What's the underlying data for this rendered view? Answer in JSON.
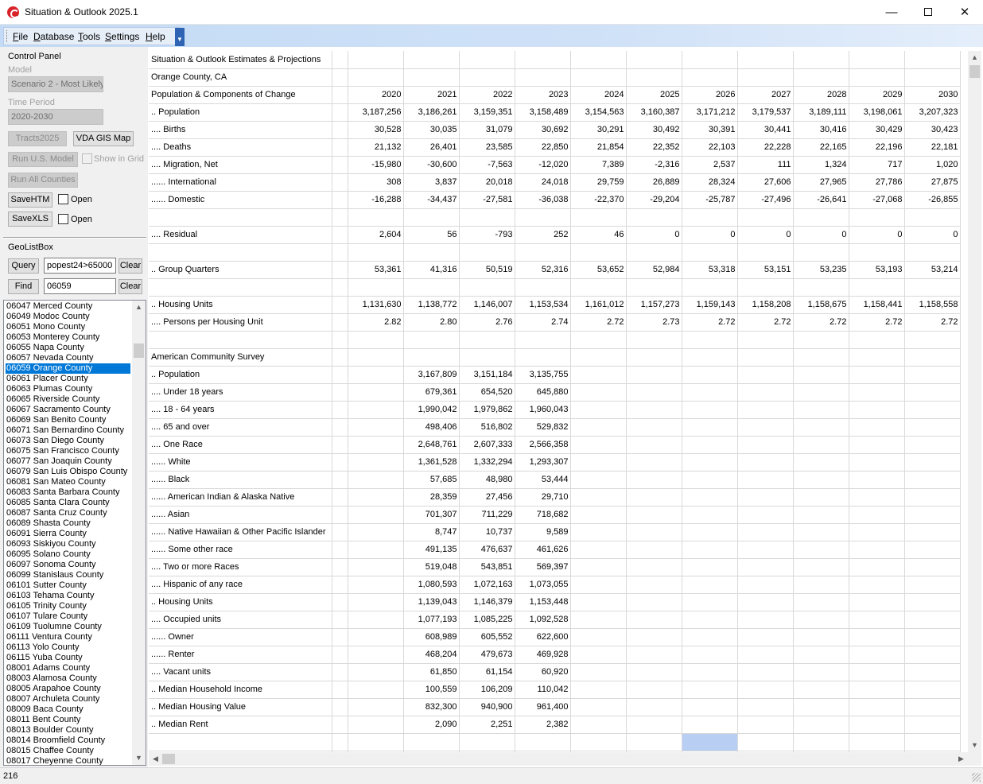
{
  "window": {
    "title": "Situation & Outlook 2025.1"
  },
  "menu": [
    {
      "pre": "",
      "u": "F",
      "post": "ile"
    },
    {
      "pre": "",
      "u": "D",
      "post": "atabase"
    },
    {
      "pre": "",
      "u": "T",
      "post": "ools"
    },
    {
      "pre": "",
      "u": "S",
      "post": "ettings"
    },
    {
      "pre": "",
      "u": "H",
      "post": "elp"
    }
  ],
  "control_panel": {
    "title": "Control Panel",
    "model_label": "Model",
    "model_value": "Scenario 2 - Most Likely",
    "period_label": "Time Period",
    "period_value": "2020-2030",
    "tracts_button": "Tracts2025",
    "gis_button": "VDA GIS Map",
    "run_us_button": "Run U.S. Model",
    "show_in_grid": "Show in Grid",
    "run_all_button": "Run All Counties",
    "save_htm_button": "SaveHTM",
    "open_htm": "Open",
    "save_xls_button": "SaveXLS",
    "open_xls": "Open"
  },
  "geolistbox": {
    "title": "GeoListBox",
    "query_button": "Query",
    "query_value": "popest24>65000",
    "clear1": "Clear",
    "find_button": "Find",
    "find_value": "06059",
    "clear2": "Clear",
    "selected": "06059 Orange County",
    "items": [
      "06047 Merced County",
      "06049 Modoc County",
      "06051 Mono County",
      "06053 Monterey County",
      "06055 Napa County",
      "06057 Nevada County",
      "06059 Orange County",
      "06061 Placer County",
      "06063 Plumas County",
      "06065 Riverside County",
      "06067 Sacramento County",
      "06069 San Benito County",
      "06071 San Bernardino County",
      "06073 San Diego County",
      "06075 San Francisco County",
      "06077 San Joaquin County",
      "06079 San Luis Obispo County",
      "06081 San Mateo County",
      "06083 Santa Barbara County",
      "06085 Santa Clara County",
      "06087 Santa Cruz County",
      "06089 Shasta County",
      "06091 Sierra County",
      "06093 Siskiyou County",
      "06095 Solano County",
      "06097 Sonoma County",
      "06099 Stanislaus County",
      "06101 Sutter County",
      "06103 Tehama County",
      "06105 Trinity County",
      "06107 Tulare County",
      "06109 Tuolumne County",
      "06111 Ventura County",
      "06113 Yolo County",
      "06115 Yuba County",
      "08001 Adams County",
      "08003 Alamosa County",
      "08005 Arapahoe County",
      "08007 Archuleta County",
      "08009 Baca County",
      "08011 Bent County",
      "08013 Boulder County",
      "08014 Broomfield County",
      "08015 Chaffee County",
      "08017 Cheyenne County"
    ]
  },
  "grid": {
    "rows": [
      {
        "label": "Situation & Outlook Estimates & Projections",
        "v": []
      },
      {
        "label": "Orange County, CA",
        "v": []
      },
      {
        "label": "Population & Components of Change",
        "v": [
          "",
          "2020",
          "2021",
          "2022",
          "2023",
          "2024",
          "2025",
          "2026",
          "2027",
          "2028",
          "2029",
          "2030"
        ]
      },
      {
        "label": ".. Population",
        "v": [
          "",
          "3,187,256",
          "3,186,261",
          "3,159,351",
          "3,158,489",
          "3,154,563",
          "3,160,387",
          "3,171,212",
          "3,179,537",
          "3,189,111",
          "3,198,061",
          "3,207,323"
        ]
      },
      {
        "label": ".... Births",
        "v": [
          "",
          "30,528",
          "30,035",
          "31,079",
          "30,692",
          "30,291",
          "30,492",
          "30,391",
          "30,441",
          "30,416",
          "30,429",
          "30,423"
        ]
      },
      {
        "label": ".... Deaths",
        "v": [
          "",
          "21,132",
          "26,401",
          "23,585",
          "22,850",
          "21,854",
          "22,352",
          "22,103",
          "22,228",
          "22,165",
          "22,196",
          "22,181"
        ]
      },
      {
        "label": ".... Migration, Net",
        "v": [
          "",
          "-15,980",
          "-30,600",
          "-7,563",
          "-12,020",
          "7,389",
          "-2,316",
          "2,537",
          "111",
          "1,324",
          "717",
          "1,020"
        ]
      },
      {
        "label": "...... International",
        "v": [
          "",
          "308",
          "3,837",
          "20,018",
          "24,018",
          "29,759",
          "26,889",
          "28,324",
          "27,606",
          "27,965",
          "27,786",
          "27,875"
        ]
      },
      {
        "label": "...... Domestic",
        "v": [
          "",
          "-16,288",
          "-34,437",
          "-27,581",
          "-36,038",
          "-22,370",
          "-29,204",
          "-25,787",
          "-27,496",
          "-26,641",
          "-27,068",
          "-26,855"
        ]
      },
      {
        "label": "",
        "v": []
      },
      {
        "label": ".... Residual",
        "v": [
          "",
          "2,604",
          "56",
          "-793",
          "252",
          "46",
          "0",
          "0",
          "0",
          "0",
          "0",
          "0"
        ]
      },
      {
        "label": "",
        "v": []
      },
      {
        "label": ".. Group Quarters",
        "v": [
          "",
          "53,361",
          "41,316",
          "50,519",
          "52,316",
          "53,652",
          "52,984",
          "53,318",
          "53,151",
          "53,235",
          "53,193",
          "53,214"
        ]
      },
      {
        "label": "",
        "v": []
      },
      {
        "label": ".. Housing Units",
        "v": [
          "",
          "1,131,630",
          "1,138,772",
          "1,146,007",
          "1,153,534",
          "1,161,012",
          "1,157,273",
          "1,159,143",
          "1,158,208",
          "1,158,675",
          "1,158,441",
          "1,158,558"
        ]
      },
      {
        "label": ".... Persons per Housing Unit",
        "v": [
          "",
          "2.82",
          "2.80",
          "2.76",
          "2.74",
          "2.72",
          "2.73",
          "2.72",
          "2.72",
          "2.72",
          "2.72",
          "2.72"
        ]
      },
      {
        "label": "",
        "v": []
      },
      {
        "label": "American Community Survey",
        "v": []
      },
      {
        "label": ".. Population",
        "v": [
          "",
          "",
          "3,167,809",
          "3,151,184",
          "3,135,755"
        ]
      },
      {
        "label": ".... Under 18 years",
        "v": [
          "",
          "",
          "679,361",
          "654,520",
          "645,880"
        ]
      },
      {
        "label": ".... 18 - 64 years",
        "v": [
          "",
          "",
          "1,990,042",
          "1,979,862",
          "1,960,043"
        ]
      },
      {
        "label": ".... 65 and over",
        "v": [
          "",
          "",
          "498,406",
          "516,802",
          "529,832"
        ]
      },
      {
        "label": ".... One Race",
        "v": [
          "",
          "",
          "2,648,761",
          "2,607,333",
          "2,566,358"
        ]
      },
      {
        "label": "...... White",
        "v": [
          "",
          "",
          "1,361,528",
          "1,332,294",
          "1,293,307"
        ]
      },
      {
        "label": "...... Black",
        "v": [
          "",
          "",
          "57,685",
          "48,980",
          "53,444"
        ]
      },
      {
        "label": "...... American Indian & Alaska Native",
        "v": [
          "",
          "",
          "28,359",
          "27,456",
          "29,710"
        ]
      },
      {
        "label": "...... Asian",
        "v": [
          "",
          "",
          "701,307",
          "711,229",
          "718,682"
        ]
      },
      {
        "label": "...... Native Hawaiian & Other Pacific Islander",
        "v": [
          "",
          "",
          "8,747",
          "10,737",
          "9,589"
        ]
      },
      {
        "label": "...... Some other race",
        "v": [
          "",
          "",
          "491,135",
          "476,637",
          "461,626"
        ]
      },
      {
        "label": ".... Two or more Races",
        "v": [
          "",
          "",
          "519,048",
          "543,851",
          "569,397"
        ]
      },
      {
        "label": ".... Hispanic of any race",
        "v": [
          "",
          "",
          "1,080,593",
          "1,072,163",
          "1,073,055"
        ]
      },
      {
        "label": ".. Housing Units",
        "v": [
          "",
          "",
          "1,139,043",
          "1,146,379",
          "1,153,448"
        ]
      },
      {
        "label": ".... Occupied units",
        "v": [
          "",
          "",
          "1,077,193",
          "1,085,225",
          "1,092,528"
        ]
      },
      {
        "label": "...... Owner",
        "v": [
          "",
          "",
          "608,989",
          "605,552",
          "622,600"
        ]
      },
      {
        "label": "...... Renter",
        "v": [
          "",
          "",
          "468,204",
          "479,673",
          "469,928"
        ]
      },
      {
        "label": ".... Vacant units",
        "v": [
          "",
          "",
          "61,850",
          "61,154",
          "60,920"
        ]
      },
      {
        "label": ".. Median Household Income",
        "v": [
          "",
          "",
          "100,559",
          "106,209",
          "110,042"
        ]
      },
      {
        "label": ".. Median Housing Value",
        "v": [
          "",
          "",
          "832,300",
          "940,900",
          "961,400"
        ]
      },
      {
        "label": ".. Median Rent",
        "v": [
          "",
          "",
          "2,090",
          "2,251",
          "2,382"
        ]
      },
      {
        "label": "",
        "v": []
      },
      {
        "label": "",
        "v": []
      }
    ]
  },
  "status": {
    "text": "216"
  },
  "colors": {
    "selection": "#0078d7",
    "cell_highlight": "#b8cff3",
    "menubar": "#cfe1f7"
  }
}
